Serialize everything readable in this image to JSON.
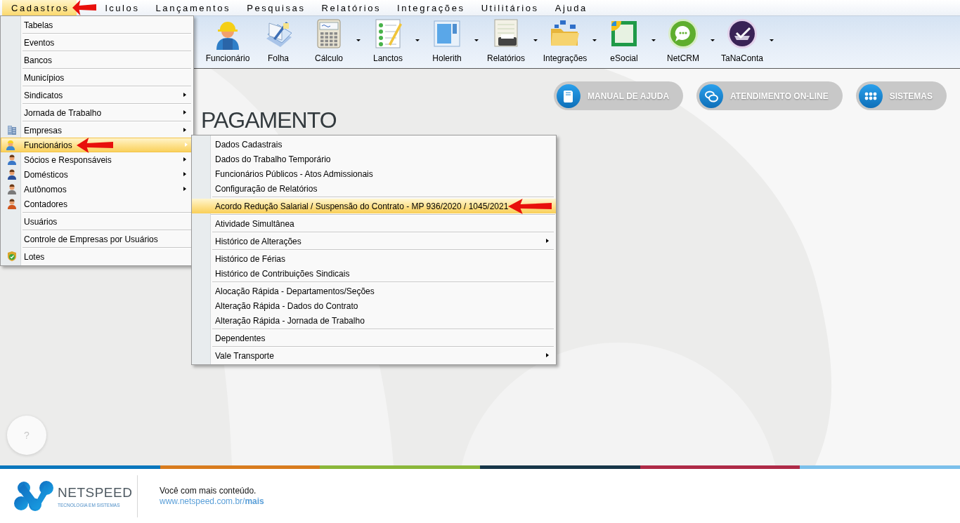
{
  "menubar": [
    {
      "label": "Cadastros",
      "selected": true,
      "arrow": true
    },
    {
      "label": "lculos",
      "selected": false,
      "arrow": false
    },
    {
      "label": "Lançamentos",
      "selected": false,
      "arrow": false
    },
    {
      "label": "Pesquisas",
      "selected": false,
      "arrow": false
    },
    {
      "label": "Relatórios",
      "selected": false,
      "arrow": false
    },
    {
      "label": "Integrações",
      "selected": false,
      "arrow": false
    },
    {
      "label": "Utilitários",
      "selected": false,
      "arrow": false
    },
    {
      "label": "Ajuda",
      "selected": false,
      "arrow": false
    }
  ],
  "toolbar": [
    {
      "label": "Funcionário",
      "kind": "worker",
      "dropdown": false
    },
    {
      "label": "Folha",
      "kind": "papers",
      "dropdown": false
    },
    {
      "label": "Cálculo",
      "kind": "calculator",
      "dropdown": true
    },
    {
      "label": "Lanctos",
      "kind": "checklist",
      "dropdown": true
    },
    {
      "label": "Holerith",
      "kind": "window",
      "dropdown": true
    },
    {
      "label": "Relatórios",
      "kind": "printer",
      "dropdown": true
    },
    {
      "label": "Integrações",
      "kind": "folder",
      "dropdown": true
    },
    {
      "label": "eSocial",
      "kind": "page",
      "dropdown": true
    },
    {
      "label": "NetCRM",
      "kind": "chat",
      "dropdown": true
    },
    {
      "label": "TaNaConta",
      "kind": "check",
      "dropdown": true
    }
  ],
  "quick_links": [
    {
      "label": "MANUAL DE AJUDA",
      "kind": "book"
    },
    {
      "label": "ATENDIMENTO ON-LINE",
      "kind": "chat"
    },
    {
      "label": "SISTEMAS",
      "kind": "grid"
    }
  ],
  "product_title": "PAGAMENTO",
  "cadastros_menu": [
    {
      "label": "Tabelas",
      "selected": false,
      "submenu": false,
      "separator": true,
      "arrow": false
    },
    {
      "label": "Eventos",
      "selected": false,
      "submenu": false,
      "separator": true,
      "arrow": false
    },
    {
      "label": "Bancos",
      "selected": false,
      "submenu": false,
      "separator": true,
      "arrow": false
    },
    {
      "label": "Municípios",
      "selected": false,
      "submenu": false,
      "separator": true,
      "arrow": false
    },
    {
      "label": "Sindicatos",
      "selected": false,
      "submenu": true,
      "separator": true,
      "arrow": false
    },
    {
      "label": "Jornada de Trabalho",
      "selected": false,
      "submenu": true,
      "separator": true,
      "arrow": false
    },
    {
      "label": "Empresas",
      "selected": false,
      "submenu": true,
      "separator": false,
      "arrow": false,
      "kind": "building"
    },
    {
      "label": "Funcionários",
      "selected": true,
      "submenu": true,
      "separator": false,
      "arrow": true,
      "kind": "worker"
    },
    {
      "label": "Sócios e Responsáveis",
      "selected": false,
      "submenu": true,
      "separator": false,
      "arrow": false,
      "kind": "person",
      "color": "#3a78c8"
    },
    {
      "label": "Domésticos",
      "selected": false,
      "submenu": true,
      "separator": false,
      "arrow": false,
      "kind": "person",
      "color": "#2a4f9a"
    },
    {
      "label": "Autônomos",
      "selected": false,
      "submenu": true,
      "separator": false,
      "arrow": false,
      "kind": "person",
      "color": "#7a7a7a"
    },
    {
      "label": "Contadores",
      "selected": false,
      "submenu": false,
      "separator": true,
      "arrow": false,
      "kind": "person",
      "color": "#d0561e"
    },
    {
      "label": "Usuários",
      "selected": false,
      "submenu": false,
      "separator": true,
      "arrow": false
    },
    {
      "label": "Controle de Empresas por Usuários",
      "selected": false,
      "submenu": false,
      "separator": true,
      "arrow": false
    },
    {
      "label": "Lotes",
      "selected": false,
      "submenu": false,
      "separator": false,
      "arrow": false,
      "kind": "shield"
    }
  ],
  "funcionarios_submenu": [
    {
      "label": "Dados Cadastrais",
      "selected": false,
      "submenu": false,
      "separator": false,
      "arrow": false
    },
    {
      "label": "Dados do Trabalho Temporário",
      "selected": false,
      "submenu": false,
      "separator": false,
      "arrow": false
    },
    {
      "label": "Funcionários Públicos - Atos Admissionais",
      "selected": false,
      "submenu": false,
      "separator": false,
      "arrow": false
    },
    {
      "label": "Configuração de Relatórios",
      "selected": false,
      "submenu": false,
      "separator": true,
      "arrow": false
    },
    {
      "label": "Acordo Redução Salarial / Suspensão do Contrato - MP 936/2020 / 1045/2021",
      "selected": true,
      "submenu": false,
      "separator": true,
      "arrow": true
    },
    {
      "label": "Atividade Simultânea",
      "selected": false,
      "submenu": false,
      "separator": true,
      "arrow": false
    },
    {
      "label": "Histórico de Alterações",
      "selected": false,
      "submenu": true,
      "separator": true,
      "arrow": false
    },
    {
      "label": "Histórico de Férias",
      "selected": false,
      "submenu": false,
      "separator": false,
      "arrow": false
    },
    {
      "label": "Histórico de Contribuições Sindicais",
      "selected": false,
      "submenu": false,
      "separator": true,
      "arrow": false
    },
    {
      "label": "Alocação Rápida - Departamentos/Seções",
      "selected": false,
      "submenu": false,
      "separator": false,
      "arrow": false
    },
    {
      "label": "Alteração Rápida - Dados do Contrato",
      "selected": false,
      "submenu": false,
      "separator": false,
      "arrow": false
    },
    {
      "label": "Alteração Rápida - Jornada de Trabalho",
      "selected": false,
      "submenu": false,
      "separator": true,
      "arrow": false
    },
    {
      "label": "Dependentes",
      "selected": false,
      "submenu": false,
      "separator": true,
      "arrow": false
    },
    {
      "label": "Vale Transporte",
      "selected": false,
      "submenu": true,
      "separator": false,
      "arrow": false
    }
  ],
  "help_button": "?",
  "footer": {
    "brand": "NETSPEED",
    "tagline": "TECNOLOGIA EM SISTEMAS",
    "message": "Você com mais conteúdo.",
    "link": "www.netspeed.com.br/**mais**"
  }
}
